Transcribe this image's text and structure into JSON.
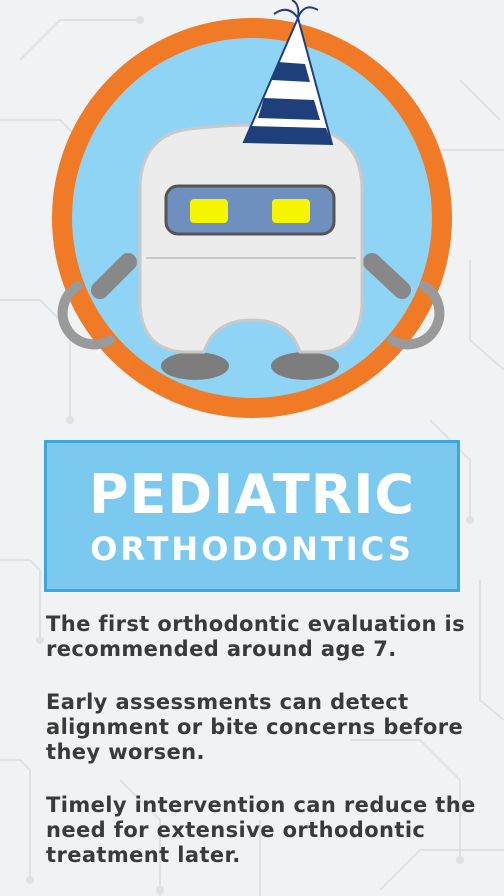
{
  "banner": {
    "title": "PEDIATRIC",
    "subtitle": "ORTHODONTICS"
  },
  "paragraphs": [
    "The first orthodontic evaluation is recommended around age 7.",
    "Early assessments can detect alignment or bite concerns before they worsen.",
    "Timely intervention can reduce the need for extensive orthodontic treatment later."
  ],
  "colors": {
    "ring": "#f07a25",
    "circle_fill": "#8fd3f5",
    "banner_fill": "#7cc9ef",
    "eyes": "#f5f500",
    "hat_stripe": "#1f3f7a",
    "text": "#3a3a3a"
  },
  "icons": [
    "tooth-robot-illustration",
    "party-hat-icon"
  ]
}
